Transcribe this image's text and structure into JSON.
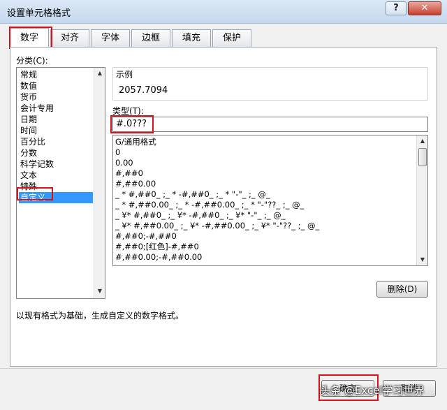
{
  "window": {
    "title": "设置单元格格式",
    "help_glyph": "?",
    "close_glyph": "✕"
  },
  "tabs": [
    {
      "label": "数字",
      "active": true
    },
    {
      "label": "对齐"
    },
    {
      "label": "字体"
    },
    {
      "label": "边框"
    },
    {
      "label": "填充"
    },
    {
      "label": "保护"
    }
  ],
  "category": {
    "label": "分类(C):",
    "items": [
      "常规",
      "数值",
      "货币",
      "会计专用",
      "日期",
      "时间",
      "百分比",
      "分数",
      "科学记数",
      "文本",
      "特殊",
      "自定义"
    ],
    "selected": "自定义"
  },
  "sample": {
    "label": "示例",
    "value": "2057.7094"
  },
  "type": {
    "label": "类型(T):",
    "value": "#.0???"
  },
  "formats": [
    "G/通用格式",
    "0",
    "0.00",
    "#,##0",
    "#,##0.00",
    "_ * #,##0_ ;_ * -#,##0_ ;_ * \"-\"_ ;_ @_",
    "_ * #,##0.00_ ;_ * -#,##0.00_ ;_ * \"-\"??_ ;_ @_",
    "_ ¥* #,##0_ ;_ ¥* -#,##0_ ;_ ¥* \"-\"_ ;_ @_",
    "_ ¥* #,##0.00_ ;_ ¥* -#,##0.00_ ;_ ¥* \"-\"??_ ;_ @_",
    "#,##0;-#,##0",
    "#,##0;[红色]-#,##0",
    "#,##0.00;-#,##0.00"
  ],
  "buttons": {
    "delete": "删除(D)",
    "ok": "确定",
    "cancel": "取消"
  },
  "description": "以现有格式为基础，生成自定义的数字格式。",
  "watermark": "头条 @Excel学习世界",
  "colors": {
    "highlight": "#d8121b",
    "selection": "#3399ff"
  }
}
